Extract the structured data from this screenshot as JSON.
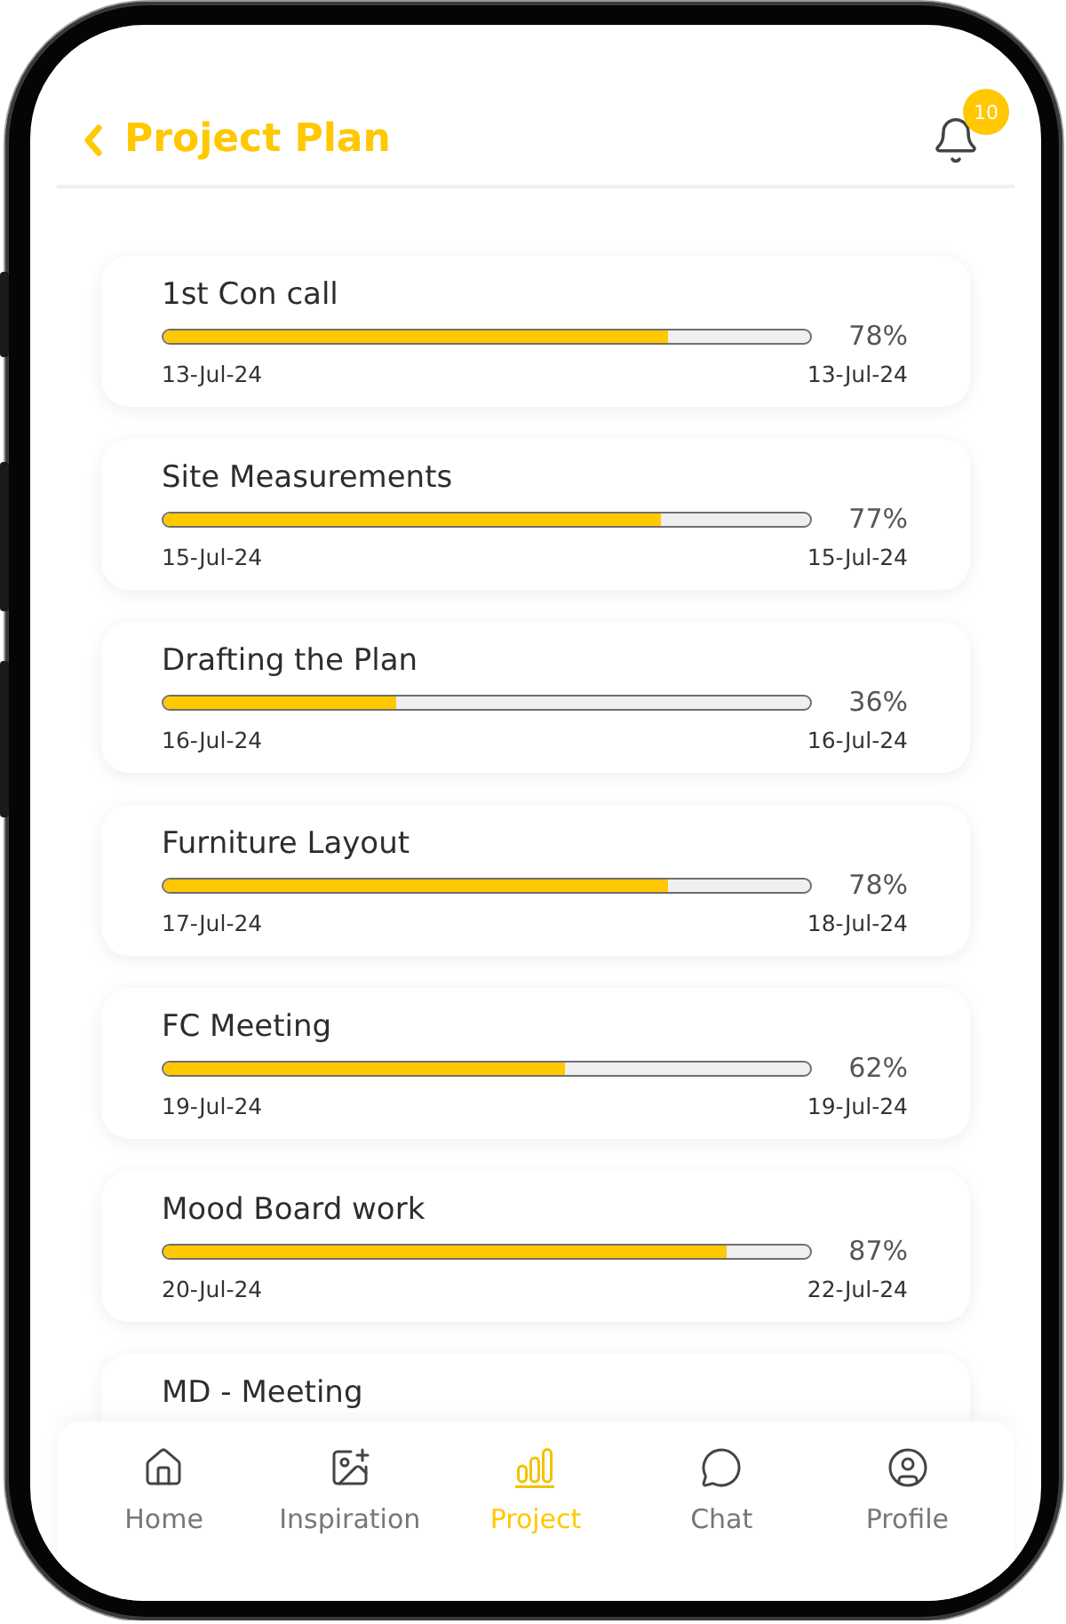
{
  "header": {
    "title": "Project Plan",
    "notification_count": "10"
  },
  "tasks": [
    {
      "name": "1st Con call",
      "level": 0.78,
      "percent": "78%",
      "start_date": "13-Jul-24",
      "end_date": "13-Jul-24"
    },
    {
      "name": "Site Measurements",
      "level": 0.77,
      "percent": "77%",
      "start_date": "15-Jul-24",
      "end_date": "15-Jul-24"
    },
    {
      "name": "Drafting the Plan",
      "level": 0.36,
      "percent": "36%",
      "start_date": "16-Jul-24",
      "end_date": "16-Jul-24"
    },
    {
      "name": "Furniture Layout",
      "level": 0.78,
      "percent": "78%",
      "start_date": "17-Jul-24",
      "end_date": "18-Jul-24"
    },
    {
      "name": "FC Meeting",
      "level": 0.62,
      "percent": "62%",
      "start_date": "19-Jul-24",
      "end_date": "19-Jul-24"
    },
    {
      "name": "Mood Board work",
      "level": 0.87,
      "percent": "87%",
      "start_date": "20-Jul-24",
      "end_date": "22-Jul-24"
    },
    {
      "name": "MD - Meeting"
    }
  ],
  "nav": [
    {
      "label": "Home",
      "kind": "home",
      "selected": false
    },
    {
      "label": "Inspiration",
      "kind": "inspiration",
      "selected": false
    },
    {
      "label": "Project",
      "kind": "project",
      "selected": true
    },
    {
      "label": "Chat",
      "kind": "chat",
      "selected": false
    },
    {
      "label": "Profile",
      "kind": "profile",
      "selected": false
    }
  ]
}
